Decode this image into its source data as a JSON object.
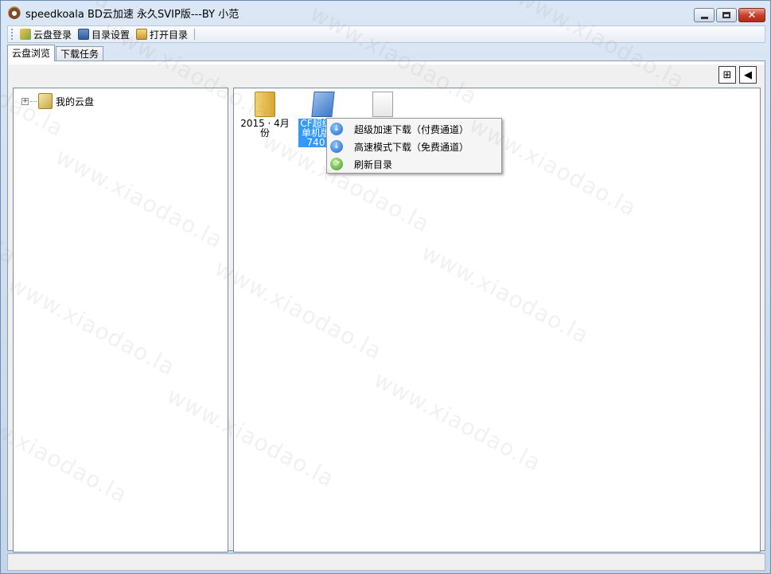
{
  "window": {
    "title": "speedkoala BD云加速 永久SVIP版---BY 小范"
  },
  "toolbar": {
    "items": [
      {
        "label": "云盘登录",
        "icon": "cloud-login-icon"
      },
      {
        "label": "目录设置",
        "icon": "directory-settings-icon"
      },
      {
        "label": "打开目录",
        "icon": "open-folder-icon"
      }
    ]
  },
  "tabs": [
    {
      "label": "云盘浏览",
      "active": true
    },
    {
      "label": "下载任务",
      "active": false
    }
  ],
  "tree": {
    "root": {
      "expander": "+",
      "label": "我的云盘"
    }
  },
  "files": [
    {
      "name_line1": "2015 · 4月",
      "name_line2": "份",
      "icon": "folder-icon"
    },
    {
      "name_line1": "CF超级",
      "name_line2": "单机版",
      "name_line3": "740",
      "icon": "blue-file-icon",
      "selected": true
    },
    {
      "name_line1": "",
      "icon": "text-file-icon"
    }
  ],
  "context_menu": {
    "items": [
      {
        "label": "超级加速下载（付费通道）",
        "icon": "download-icon"
      },
      {
        "label": "高速模式下载（免费通道）",
        "icon": "download-icon"
      },
      {
        "label": "刷新目录",
        "icon": "refresh-icon"
      }
    ]
  },
  "watermark": {
    "text": "www.xiaodao.la"
  }
}
